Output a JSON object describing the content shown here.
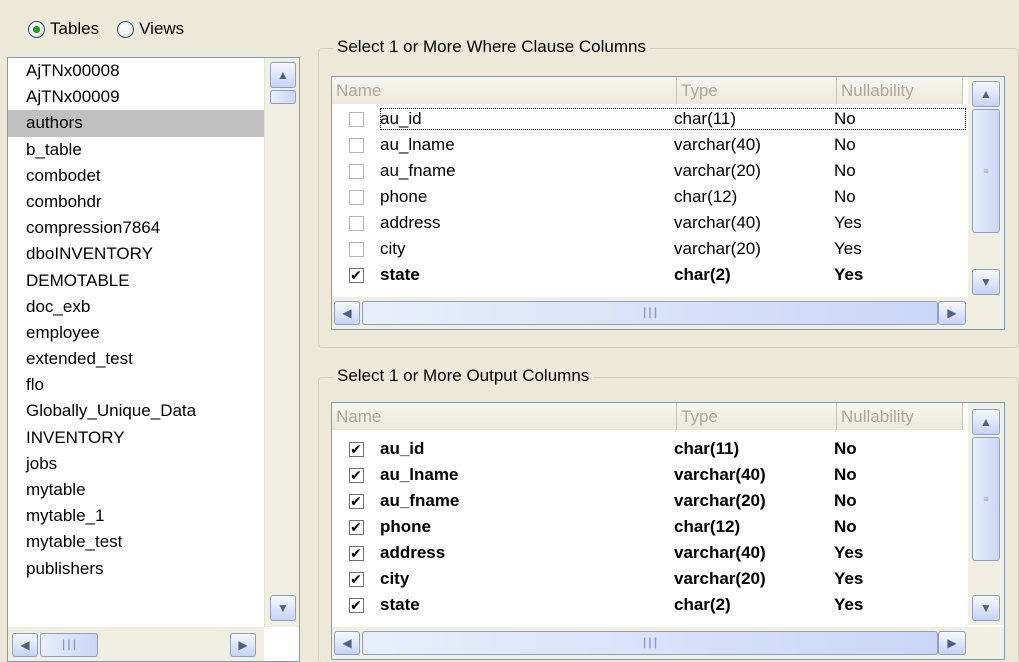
{
  "object_type": {
    "tables_label": "Tables",
    "views_label": "Views",
    "selected": "tables"
  },
  "table_list": {
    "items": [
      "AjTNx00008",
      "AjTNx00009",
      "authors",
      "b_table",
      "combodet",
      "combohdr",
      "compression7864",
      "dboINVENTORY",
      "DEMOTABLE",
      "doc_exb",
      "employee",
      "extended_test",
      "flo",
      "Globally_Unique_Data",
      "INVENTORY",
      "jobs",
      "mytable",
      "mytable_1",
      "mytable_test",
      "publishers"
    ],
    "selected_index": 2
  },
  "where_clause": {
    "title": "Select 1 or More Where Clause Columns",
    "headers": {
      "name": "Name",
      "type": "Type",
      "nullability": "Nullability"
    },
    "rows": [
      {
        "checked": false,
        "name": "au_id",
        "type": "char(11)",
        "nullability": "No"
      },
      {
        "checked": false,
        "name": "au_lname",
        "type": "varchar(40)",
        "nullability": "No"
      },
      {
        "checked": false,
        "name": "au_fname",
        "type": "varchar(20)",
        "nullability": "No"
      },
      {
        "checked": false,
        "name": "phone",
        "type": "char(12)",
        "nullability": "No"
      },
      {
        "checked": false,
        "name": "address",
        "type": "varchar(40)",
        "nullability": "Yes"
      },
      {
        "checked": false,
        "name": "city",
        "type": "varchar(20)",
        "nullability": "Yes"
      },
      {
        "checked": true,
        "name": "state",
        "type": "char(2)",
        "nullability": "Yes"
      }
    ]
  },
  "output_columns": {
    "title": "Select 1 or More Output Columns",
    "headers": {
      "name": "Name",
      "type": "Type",
      "nullability": "Nullability"
    },
    "rows": [
      {
        "checked": true,
        "name": "au_id",
        "type": "char(11)",
        "nullability": "No"
      },
      {
        "checked": true,
        "name": "au_lname",
        "type": "varchar(40)",
        "nullability": "No"
      },
      {
        "checked": true,
        "name": "au_fname",
        "type": "varchar(20)",
        "nullability": "No"
      },
      {
        "checked": true,
        "name": "phone",
        "type": "char(12)",
        "nullability": "No"
      },
      {
        "checked": true,
        "name": "address",
        "type": "varchar(40)",
        "nullability": "Yes"
      },
      {
        "checked": true,
        "name": "city",
        "type": "varchar(20)",
        "nullability": "Yes"
      },
      {
        "checked": true,
        "name": "state",
        "type": "char(2)",
        "nullability": "Yes"
      }
    ]
  },
  "icons": {
    "scroll_up": "▲",
    "scroll_down": "▼",
    "scroll_left": "◀",
    "scroll_right": "▶",
    "check": "✔"
  }
}
